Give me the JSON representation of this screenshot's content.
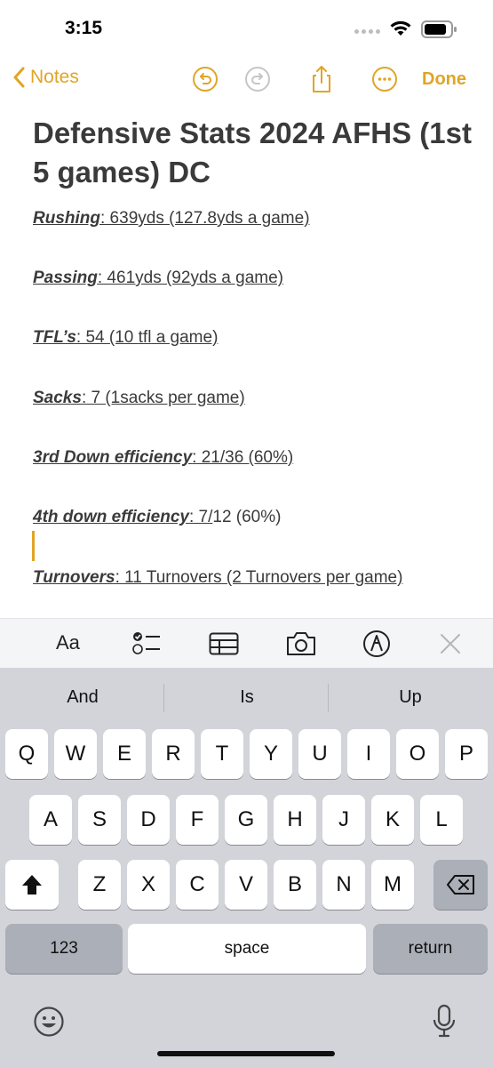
{
  "status_bar": {
    "time": "3:15"
  },
  "nav": {
    "back_label": "Notes",
    "done_label": "Done",
    "accent": "#E0A526",
    "icons": [
      "undo-icon",
      "redo-icon",
      "share-icon",
      "more-icon"
    ]
  },
  "note": {
    "title": "Defensive Stats 2024 AFHS (1st 5 games) DC",
    "lines": [
      {
        "label": "Rushing",
        "rest": ": 639yds (127.8yds a game)"
      },
      {
        "label": "Passing",
        "rest": ": 461yds (92yds a game)"
      },
      {
        "label": "TFL’s",
        "pre": ": 54 (10 ",
        "err": "tfl",
        "post": " a game)"
      },
      {
        "label": "Sacks",
        "rest": ": 7 (1sacks per game)"
      },
      {
        "label": "3rd Down efficiency",
        "rest": ": 21/36 (60%)"
      },
      {
        "label": "4th down efficiency",
        "rest_u": ": 7/",
        "rest_plain": "12 (60%)"
      },
      {
        "label": "Turnovers",
        "rest": ": 11 Turnovers (2 Turnovers per game)"
      }
    ]
  },
  "format_bar": {
    "aa_label": "Aa",
    "icons": [
      "checklist-icon",
      "table-icon",
      "camera-icon",
      "markup-icon",
      "close-icon"
    ]
  },
  "keyboard": {
    "suggestions": [
      "And",
      "Is",
      "Up"
    ],
    "row1": [
      "Q",
      "W",
      "E",
      "R",
      "T",
      "Y",
      "U",
      "I",
      "O",
      "P"
    ],
    "row2": [
      "A",
      "S",
      "D",
      "F",
      "G",
      "H",
      "J",
      "K",
      "L"
    ],
    "row3": [
      "Z",
      "X",
      "C",
      "V",
      "B",
      "N",
      "M"
    ],
    "numbers_label": "123",
    "space_label": "space",
    "return_label": "return"
  }
}
